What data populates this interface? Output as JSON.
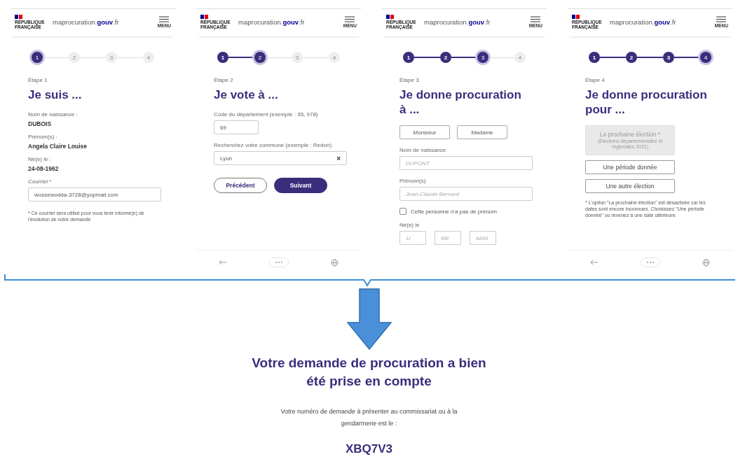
{
  "panels": [
    {
      "header": {
        "logo": "RÉPUBLIQUE FRANÇAISE",
        "site": "maprocuration.**gouv**.fr",
        "menu": "MENU"
      },
      "steps": [
        {
          "label": "1",
          "completed": false,
          "selected": true
        },
        {
          "label": "2",
          "completed": false,
          "selected": false
        },
        {
          "label": "3",
          "completed": false,
          "selected": false
        },
        {
          "label": "4",
          "completed": false,
          "selected": false
        }
      ],
      "step_label": "Étape 1",
      "title": "Je suis ...",
      "items": [
        {
          "kind": "info",
          "label": "Nom de naissance :",
          "value": "DUBOIS"
        },
        {
          "kind": "info",
          "label": "Prénom(s) :",
          "value": "Angela Claire Louise"
        },
        {
          "kind": "info",
          "label": "Né(e) le :",
          "value": "24-08-1962"
        },
        {
          "kind": "field",
          "label": "Courriel *",
          "value": "wossewodda-3728@yopmail.com"
        }
      ],
      "footnote": "* Ce courriel sera utilisé pour vous tenir informé(e) de l'évolution de votre demande",
      "nav_bar": false
    },
    {
      "header": {
        "logo": "RÉPUBLIQUE FRANÇAISE",
        "site": "maprocuration.**gouv**.fr",
        "menu": "MENU"
      },
      "steps": [
        {
          "label": "1",
          "completed": true,
          "selected": false
        },
        {
          "label": "2",
          "completed": false,
          "selected": true
        },
        {
          "label": "3",
          "completed": false,
          "selected": false
        },
        {
          "label": "4",
          "completed": false,
          "selected": false
        }
      ],
      "step_label": "Étape 2",
      "title": "Je vote à ...",
      "items": [
        {
          "kind": "field",
          "label": "Code du département (exemple : 35, 978)",
          "value": "69",
          "short": true
        },
        {
          "kind": "field",
          "label": "Recherchez votre commune (exemple : Redon)",
          "value": "Lyon",
          "clearable": true,
          "clear": "×"
        },
        {
          "kind": "buttons",
          "buttons": [
            {
              "label": "Précédent",
              "primary": false
            },
            {
              "label": "Suivant",
              "primary": true
            }
          ]
        }
      ],
      "nav_bar": true
    },
    {
      "header": {
        "logo": "RÉPUBLIQUE FRANÇAISE",
        "site": "maprocuration.**gouv**.fr",
        "menu": "MENU"
      },
      "steps": [
        {
          "label": "1",
          "completed": true,
          "selected": false
        },
        {
          "label": "2",
          "completed": true,
          "selected": false
        },
        {
          "label": "3",
          "completed": false,
          "selected": true
        },
        {
          "label": "4",
          "completed": false,
          "selected": false
        }
      ],
      "step_label": "Étape 3",
      "title": "Je donne procuration à ...",
      "items": [
        {
          "kind": "toggle",
          "options": [
            {
              "label": "Monsieur",
              "selected": false
            },
            {
              "label": "Madame",
              "selected": false
            }
          ]
        },
        {
          "kind": "field",
          "label": "Nom de naissance",
          "placeholder": "DUPONT"
        },
        {
          "kind": "field",
          "label": "Prénom(s)",
          "placeholder": "Jean-Claude Bernard"
        },
        {
          "kind": "checkbox",
          "label": "Cette personne n'a pas de prénom",
          "checked": false
        },
        {
          "kind": "date",
          "label": "Né(e) le",
          "fields": [
            "JJ",
            "MM",
            "AAAA"
          ]
        }
      ],
      "nav_bar": false
    },
    {
      "header": {
        "logo": "RÉPUBLIQUE FRANÇAISE",
        "site": "maprocuration.**gouv**.fr",
        "menu": "MENU"
      },
      "steps": [
        {
          "label": "1",
          "completed": true,
          "selected": false
        },
        {
          "label": "2",
          "completed": true,
          "selected": false
        },
        {
          "label": "3",
          "completed": true,
          "selected": false
        },
        {
          "label": "4",
          "completed": false,
          "selected": true
        }
      ],
      "step_label": "Étape 4",
      "title": "Je donne procuration pour ...",
      "items": [
        {
          "kind": "choice",
          "label": "La prochaine élection *",
          "sublabel": "(Élections départementales et régionales 2021)",
          "disabled": true
        },
        {
          "kind": "choice",
          "label": "Une période donnée",
          "disabled": false
        },
        {
          "kind": "choice",
          "label": "Une autre élection",
          "disabled": false
        }
      ],
      "footnote": "* L'option \"La prochaine élection\" est désactivée car les dates sont encore inconnues. Choisissez \"Une période donnée\" ou revenez à une date ultérieure.",
      "nav_bar": true
    }
  ],
  "confirmation": {
    "title": "Votre demande de procuration a bien été prise en compte",
    "message": "Votre numéro de demande à présenter au commissariat ou à la gendarmerie est le :",
    "code": "XBQ7V3"
  }
}
